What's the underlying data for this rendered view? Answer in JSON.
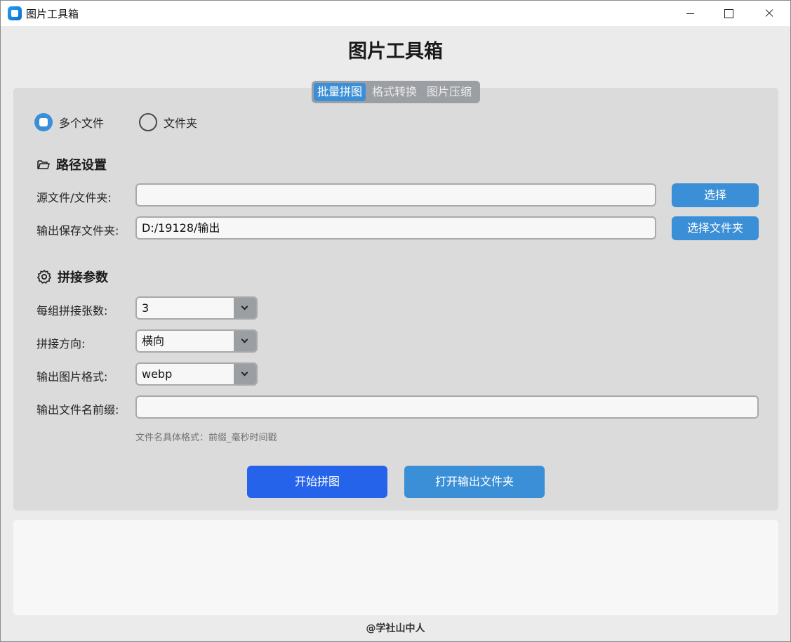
{
  "window": {
    "title": "图片工具箱"
  },
  "heading": "图片工具箱",
  "tabs": [
    {
      "label": "批量拼图",
      "active": true
    },
    {
      "label": "格式转换",
      "active": false
    },
    {
      "label": "图片压缩",
      "active": false
    }
  ],
  "mode": {
    "options": [
      {
        "label": "多个文件",
        "selected": true
      },
      {
        "label": "文件夹",
        "selected": false
      }
    ]
  },
  "path_section": {
    "title": "路径设置",
    "icon": "folder-open-icon",
    "source_label": "源文件/文件夹:",
    "source_value": "",
    "source_button": "选择",
    "output_label": "输出保存文件夹:",
    "output_value": "D:/19128/输出",
    "output_button": "选择文件夹"
  },
  "params_section": {
    "title": "拼接参数",
    "icon": "gear-icon",
    "per_group_label": "每组拼接张数:",
    "per_group_value": "3",
    "direction_label": "拼接方向:",
    "direction_value": "横向",
    "format_label": "输出图片格式:",
    "format_value": "webp",
    "prefix_label": "输出文件名前缀:",
    "prefix_value": "",
    "prefix_hint": "文件名具体格式：前缀_毫秒时间戳"
  },
  "actions": {
    "start": "开始拼图",
    "open_output": "打开输出文件夹"
  },
  "log": {
    "text": ""
  },
  "footer": "@学社山中人",
  "colors": {
    "accent": "#3b8fd6",
    "primary_button": "#2563eb",
    "panel": "#dbdbdb",
    "background": "#ebebeb"
  }
}
